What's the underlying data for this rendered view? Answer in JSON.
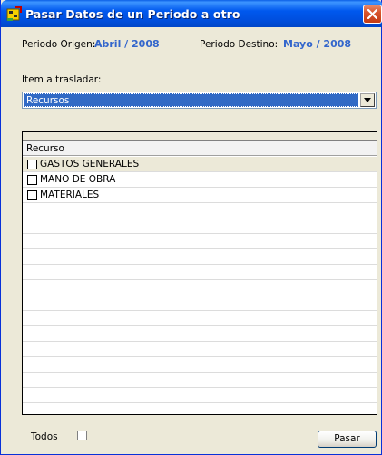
{
  "window": {
    "title": "Pasar Datos de un Periodo a otro",
    "icon": "app-tool-icon",
    "close_icon": "close-icon"
  },
  "periods": {
    "origin_label": "Periodo Origen:",
    "origin_value": "Abril / 2008",
    "dest_label": "Periodo Destino:",
    "dest_value": "Mayo / 2008"
  },
  "item": {
    "label": "Item a trasladar:",
    "selected": "Recursos"
  },
  "grid": {
    "column_header": "Recurso",
    "rows": [
      {
        "label": "GASTOS GENERALES",
        "checked": false,
        "selected": true
      },
      {
        "label": "MANO DE OBRA",
        "checked": false,
        "selected": false
      },
      {
        "label": "MATERIALES",
        "checked": false,
        "selected": false
      }
    ],
    "empty_rows": 14
  },
  "footer": {
    "todos_label": "Todos",
    "todos_checked": false,
    "pasar_label": "Pasar"
  },
  "colors": {
    "titlebar": "#0054e3",
    "value_text": "#3366cc",
    "selection": "#316ac5",
    "window_bg": "#ece9d8"
  }
}
